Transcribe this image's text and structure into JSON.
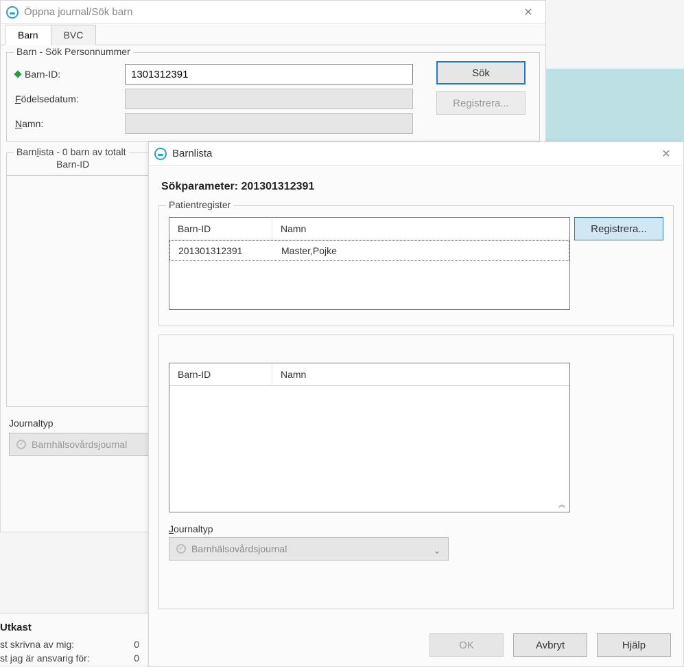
{
  "win1": {
    "title": "Öppna journal/Sök barn",
    "tabs": {
      "barn": "Barn",
      "bvc": "BVC"
    },
    "search": {
      "legend": "Barn - Sök Personnummer",
      "barn_id_label": "Barn-ID:",
      "barn_id_value": "1301312391",
      "dob_label": "Födelsedatum:",
      "dob_underline": "F",
      "name_label": "Namn:",
      "name_underline": "N",
      "sok_btn": "Sök",
      "registrera_btn": "Registrera..."
    },
    "barnlista": {
      "legend_prefix": "Barn",
      "legend_underline": "l",
      "legend_suffix": "ista - 0 barn av totalt",
      "col_barn_id": "Barn-ID"
    },
    "journaltyp": {
      "label": "Journaltyp",
      "value": "Barnhälsovårdsjournal"
    }
  },
  "win2": {
    "title": "Barnlista",
    "sokparam_label": "Sökparameter: ",
    "sokparam_value": "201301312391",
    "patientregister": {
      "legend": "Patientregister",
      "col_barn_id": "Barn-ID",
      "col_namn": "Namn",
      "rows": [
        {
          "barn_id": "201301312391",
          "namn": "Master,Pojke"
        }
      ],
      "registrera_btn": "Registrera..."
    },
    "lower": {
      "col_barn_id": "Barn-ID",
      "col_namn": "Namn"
    },
    "journaltyp": {
      "label_underline": "J",
      "label_rest": "ournaltyp",
      "value": "Barnhälsovårdsjournal"
    },
    "buttons": {
      "ok": "OK",
      "avbryt": "Avbryt",
      "hjalp": "Hjälp"
    }
  },
  "utkast": {
    "heading": "Utkast",
    "row1_label": "st skrivna av mig:",
    "row1_val": "0",
    "row2_label": "st jag är ansvarig för:",
    "row2_val": "0"
  }
}
